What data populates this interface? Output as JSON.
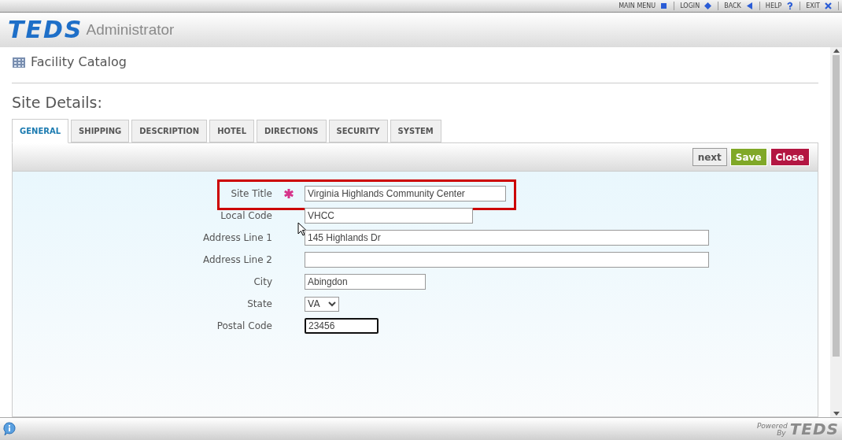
{
  "top_menu": [
    {
      "label": "MAIN MENU"
    },
    {
      "label": "LOGIN"
    },
    {
      "label": "BACK"
    },
    {
      "label": "HELP"
    },
    {
      "label": "EXIT"
    }
  ],
  "header": {
    "logo": "TEDS",
    "title": "Administrator"
  },
  "page_title": "Facility Catalog",
  "section_title": "Site Details:",
  "tabs": [
    {
      "label": "GENERAL",
      "selected": true
    },
    {
      "label": "SHIPPING",
      "selected": false
    },
    {
      "label": "DESCRIPTION",
      "selected": false
    },
    {
      "label": "HOTEL",
      "selected": false
    },
    {
      "label": "DIRECTIONS",
      "selected": false
    },
    {
      "label": "SECURITY",
      "selected": false
    },
    {
      "label": "SYSTEM",
      "selected": false
    }
  ],
  "toolbar_buttons": [
    {
      "label": "next",
      "kind": "neutral"
    },
    {
      "label": "Save",
      "kind": "save"
    },
    {
      "label": "Close",
      "kind": "close"
    }
  ],
  "fields": [
    {
      "label": "Site Title",
      "value": "Virginia Highlands Community Center",
      "kind": "text",
      "required": true,
      "highlighted": true,
      "focused": false
    },
    {
      "label": "Local Code",
      "value": "VHCC",
      "kind": "text",
      "required": false,
      "highlighted": false,
      "focused": false
    },
    {
      "label": "Address Line 1",
      "value": "145 Highlands Dr",
      "kind": "text",
      "required": false,
      "highlighted": false,
      "focused": false
    },
    {
      "label": "Address Line 2",
      "kind": "text",
      "required": false,
      "highlighted": false,
      "focused": false
    },
    {
      "label": "City",
      "value": "Abingdon",
      "kind": "text",
      "required": false,
      "highlighted": false,
      "focused": false
    },
    {
      "label": "State",
      "value": "VA",
      "kind": "select",
      "required": false,
      "highlighted": false,
      "focused": false
    },
    {
      "label": "Postal Code",
      "value": "23456",
      "kind": "text",
      "required": false,
      "highlighted": false,
      "focused": true
    }
  ],
  "footer": {
    "powered": "Powered",
    "by": "By",
    "logo": "TEDS"
  }
}
